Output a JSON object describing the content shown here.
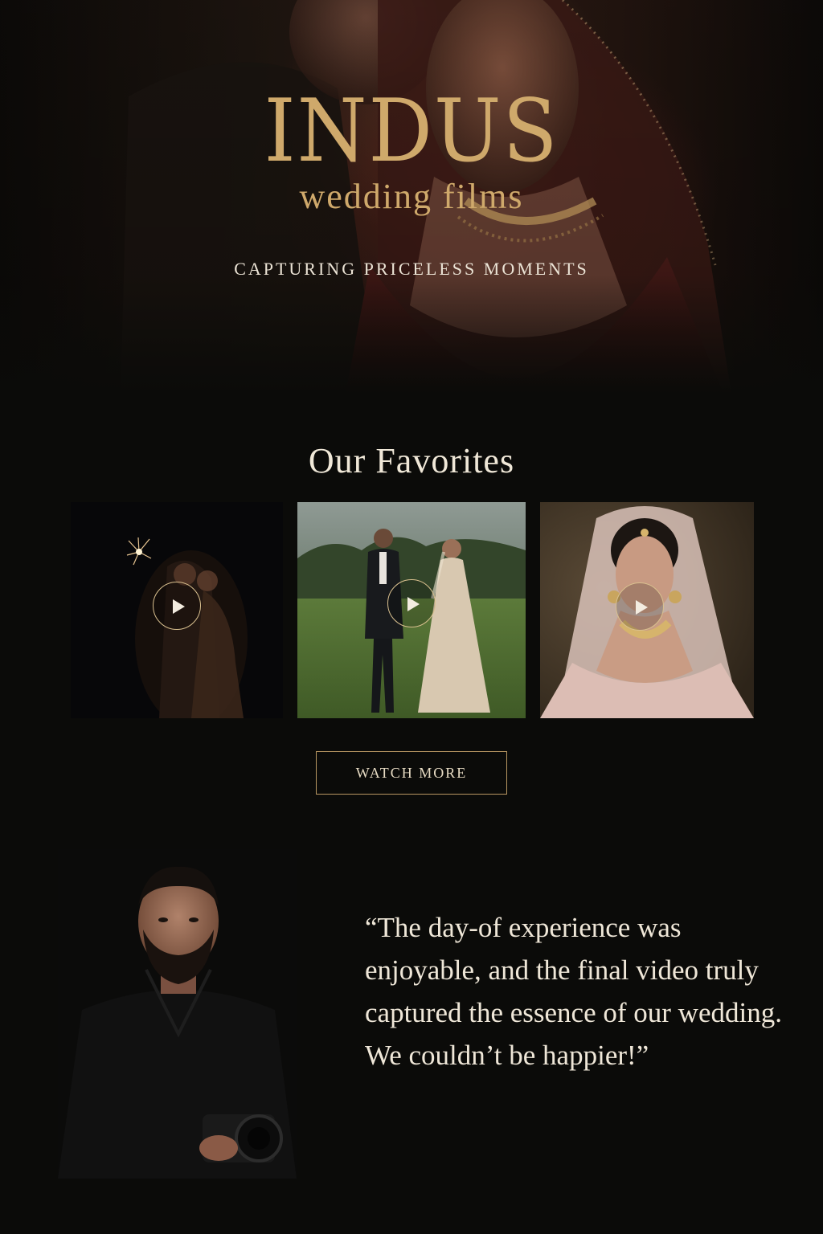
{
  "hero": {
    "brand_name": "INDUS",
    "brand_sub": "wedding films",
    "tagline": "CAPTURING PRICELESS MOMENTS"
  },
  "favorites": {
    "title": "Our Favorites",
    "videos": [
      {
        "name": "sparkler-night-film",
        "icon": "play-icon"
      },
      {
        "name": "field-walk-film",
        "icon": "play-icon"
      },
      {
        "name": "bridal-portrait-film",
        "icon": "play-icon"
      }
    ],
    "watch_more_label": "WATCH MORE"
  },
  "testimonial": {
    "quote": "“The day-of experience was enjoyable, and the final video truly captured the essence of our wedding. We couldn’t be happier!”"
  },
  "colors": {
    "background": "#0b0b09",
    "gold": "#cfa96b",
    "text": "#efe7d8"
  }
}
